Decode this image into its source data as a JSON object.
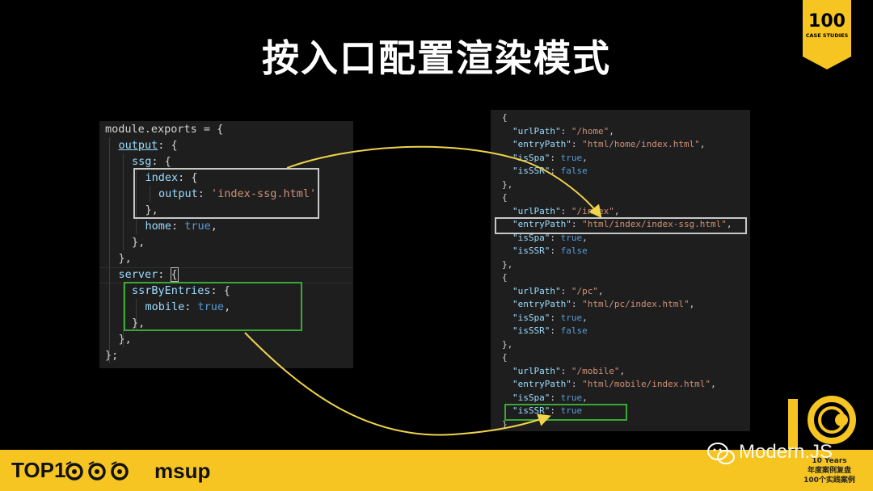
{
  "slide": {
    "title": "按入口配置渲染模式"
  },
  "badge": {
    "number": "100",
    "subtitle": "CASE STUDIES",
    "color": "#f6c522"
  },
  "left_code": [
    [
      [
        "module.exports",
        "plain"
      ],
      [
        " = {",
        "punct"
      ]
    ],
    [
      [
        "output",
        "key-ul"
      ],
      [
        ": {",
        "punct"
      ]
    ],
    [
      [
        "ssg",
        "key"
      ],
      [
        ": {",
        "punct"
      ]
    ],
    [
      [
        "index",
        "key"
      ],
      [
        ": {",
        "punct"
      ]
    ],
    [
      [
        "output",
        "key"
      ],
      [
        ": ",
        "punct"
      ],
      [
        "'index-ssg.html'",
        "str"
      ]
    ],
    [
      [
        "},",
        "punct"
      ]
    ],
    [
      [
        "home",
        "key"
      ],
      [
        ": ",
        "punct"
      ],
      [
        "true",
        "bool"
      ],
      [
        ",",
        "punct"
      ]
    ],
    [
      [
        "},",
        "punct"
      ]
    ],
    [
      [
        "},",
        "punct"
      ]
    ],
    [
      [
        "server",
        "key"
      ],
      [
        ": ",
        "punct"
      ],
      [
        "{",
        "cursor"
      ]
    ],
    [
      [
        "ssrByEntries",
        "key"
      ],
      [
        ": {",
        "punct"
      ]
    ],
    [
      [
        "mobile",
        "key"
      ],
      [
        ": ",
        "punct"
      ],
      [
        "true",
        "bool"
      ],
      [
        ",",
        "punct"
      ]
    ],
    [
      [
        "},",
        "punct"
      ]
    ],
    [
      [
        "},",
        "punct"
      ]
    ],
    [
      [
        "};",
        "punct"
      ]
    ]
  ],
  "right_code": [
    [
      [
        "{",
        "punct"
      ]
    ],
    [
      [
        "\"urlPath\"",
        "key"
      ],
      [
        ": ",
        "punct"
      ],
      [
        "\"/home\"",
        "str"
      ],
      [
        ",",
        "punct"
      ]
    ],
    [
      [
        "\"entryPath\"",
        "key"
      ],
      [
        ": ",
        "punct"
      ],
      [
        "\"html/home/index.html\"",
        "str"
      ],
      [
        ",",
        "punct"
      ]
    ],
    [
      [
        "\"isSpa\"",
        "key"
      ],
      [
        ": ",
        "punct"
      ],
      [
        "true",
        "bool"
      ],
      [
        ",",
        "punct"
      ]
    ],
    [
      [
        "\"isSSR\"",
        "key"
      ],
      [
        ": ",
        "punct"
      ],
      [
        "false",
        "bool"
      ]
    ],
    [
      [
        "},",
        "punct"
      ]
    ],
    [
      [
        "{",
        "punct"
      ]
    ],
    [
      [
        "\"urlPath\"",
        "key"
      ],
      [
        ": ",
        "punct"
      ],
      [
        "\"/index\"",
        "str"
      ],
      [
        ",",
        "punct"
      ]
    ],
    [
      [
        "\"entryPath\"",
        "key"
      ],
      [
        ": ",
        "punct"
      ],
      [
        "\"html/index/index-ssg.html\"",
        "str"
      ],
      [
        ",",
        "punct"
      ]
    ],
    [
      [
        "\"isSpa\"",
        "key"
      ],
      [
        ": ",
        "punct"
      ],
      [
        "true",
        "bool"
      ],
      [
        ",",
        "punct"
      ]
    ],
    [
      [
        "\"isSSR\"",
        "key"
      ],
      [
        ": ",
        "punct"
      ],
      [
        "false",
        "bool"
      ]
    ],
    [
      [
        "},",
        "punct"
      ]
    ],
    [
      [
        "{",
        "punct"
      ]
    ],
    [
      [
        "\"urlPath\"",
        "key"
      ],
      [
        ": ",
        "punct"
      ],
      [
        "\"/pc\"",
        "str"
      ],
      [
        ",",
        "punct"
      ]
    ],
    [
      [
        "\"entryPath\"",
        "key"
      ],
      [
        ": ",
        "punct"
      ],
      [
        "\"html/pc/index.html\"",
        "str"
      ],
      [
        ",",
        "punct"
      ]
    ],
    [
      [
        "\"isSpa\"",
        "key"
      ],
      [
        ": ",
        "punct"
      ],
      [
        "true",
        "bool"
      ],
      [
        ",",
        "punct"
      ]
    ],
    [
      [
        "\"isSSR\"",
        "key"
      ],
      [
        ": ",
        "punct"
      ],
      [
        "false",
        "bool"
      ]
    ],
    [
      [
        "},",
        "punct"
      ]
    ],
    [
      [
        "{",
        "punct"
      ]
    ],
    [
      [
        "\"urlPath\"",
        "key"
      ],
      [
        ": ",
        "punct"
      ],
      [
        "\"/mobile\"",
        "str"
      ],
      [
        ",",
        "punct"
      ]
    ],
    [
      [
        "\"entryPath\"",
        "key"
      ],
      [
        ": ",
        "punct"
      ],
      [
        "\"html/mobile/index.html\"",
        "str"
      ],
      [
        ",",
        "punct"
      ]
    ],
    [
      [
        "\"isSpa\"",
        "key"
      ],
      [
        ": ",
        "punct"
      ],
      [
        "true",
        "bool"
      ],
      [
        ",",
        "punct"
      ]
    ],
    [
      [
        "\"isSSR\"",
        "key"
      ],
      [
        ": ",
        "punct"
      ],
      [
        "true",
        "bool"
      ]
    ],
    [
      [
        "}",
        "punct"
      ]
    ]
  ],
  "footer": {
    "brand_left": "TOP1",
    "brand_right": "msup",
    "watermark": "Modern.JS",
    "ten_years": "10 Years",
    "ten_line1": "年度案例复盘",
    "ten_line2": "100个实践案例",
    "bar_color": "#f6c522"
  },
  "colors": {
    "code_bg": "#1e1e1e",
    "key": "#9cdcfe",
    "string": "#ce9178",
    "boolean": "#569cd6",
    "highlight_gray": "#c8c8c8",
    "highlight_green": "#3aa736",
    "arrow": "#f0d44a"
  }
}
